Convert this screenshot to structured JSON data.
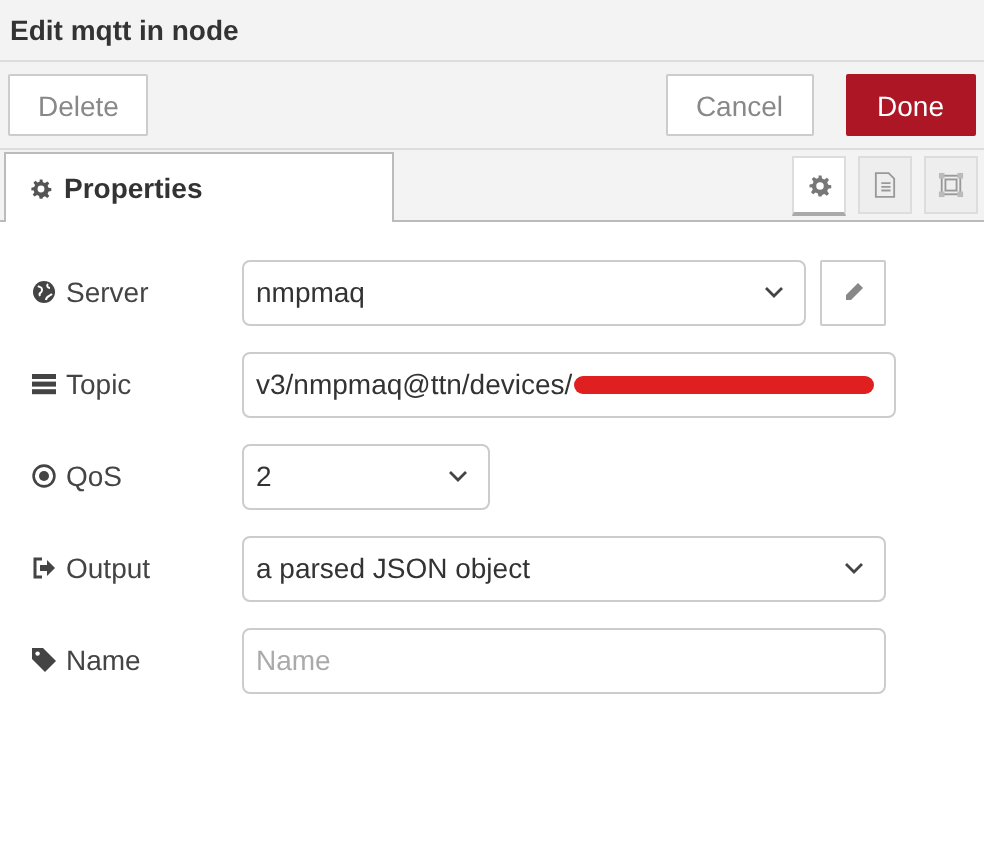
{
  "window": {
    "title": "Edit mqtt in node"
  },
  "toolbar": {
    "left": [
      {
        "label": "Delete",
        "kind": "plain"
      }
    ],
    "right": [
      {
        "label": "Cancel",
        "kind": "plain"
      },
      {
        "label": "Done",
        "kind": "primary"
      }
    ]
  },
  "tabs": [
    {
      "label": "Properties",
      "selected": true
    }
  ],
  "side_tabs": [
    {
      "kind": "gear",
      "selected": true
    },
    {
      "kind": "document",
      "selected": false
    },
    {
      "kind": "frame",
      "selected": false
    }
  ],
  "fields": [
    {
      "label": "Server",
      "kind": "select",
      "value": "nmpmaq",
      "edit_button": true
    },
    {
      "label": "Topic",
      "kind": "text",
      "value": "v3/nmpmaq@ttn/devices/",
      "redacted": true
    },
    {
      "label": "QoS",
      "kind": "select",
      "value": "2",
      "narrow": true
    },
    {
      "label": "Output",
      "kind": "select",
      "value": "a parsed JSON object"
    },
    {
      "label": "Name",
      "kind": "text",
      "placeholder": "Name"
    }
  ]
}
